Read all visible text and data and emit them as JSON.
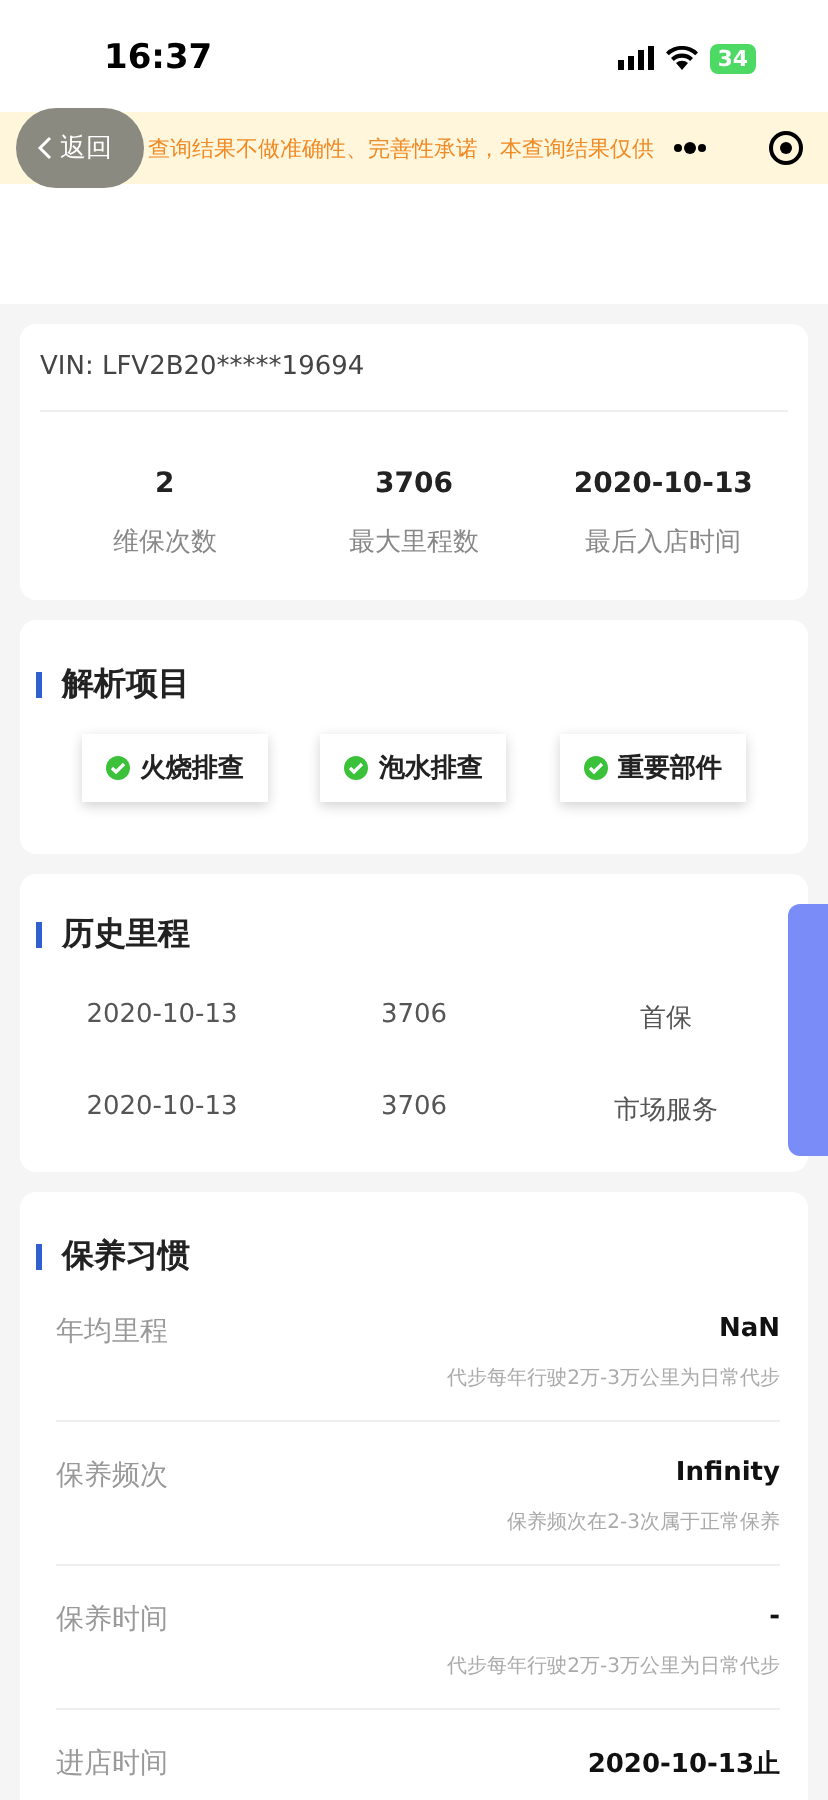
{
  "status_bar": {
    "time": "16:37",
    "battery": "34"
  },
  "nav": {
    "back": "返回",
    "notice": "查询结果不做准确性、完善性承诺，本查询结果仅供"
  },
  "vin": "VIN: LFV2B20*****19694",
  "summary": [
    {
      "value": "2",
      "label": "维保次数"
    },
    {
      "value": "3706",
      "label": "最大里程数"
    },
    {
      "value": "2020-10-13",
      "label": "最后入店时间"
    }
  ],
  "analysis": {
    "title": "解析项目",
    "items": [
      "火烧排查",
      "泡水排查",
      "重要部件"
    ]
  },
  "history": {
    "title": "历史里程",
    "rows": [
      [
        "2020-10-13",
        "3706",
        "首保"
      ],
      [
        "2020-10-13",
        "3706",
        "市场服务"
      ]
    ]
  },
  "habits": {
    "title": "保养习惯",
    "rows": [
      {
        "label": "年均里程",
        "value": "NaN",
        "note": "代步每年行驶2万-3万公里为日常代步"
      },
      {
        "label": "保养频次",
        "value": "Infinity",
        "note": "保养频次在2-3次属于正常保养"
      },
      {
        "label": "保养时间",
        "value": "-",
        "note": "代步每年行驶2万-3万公里为日常代步"
      },
      {
        "label": "进店时间",
        "value": "2020-10-13止"
      }
    ]
  }
}
